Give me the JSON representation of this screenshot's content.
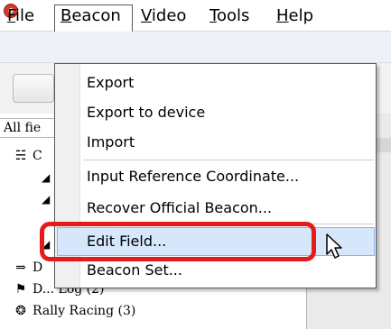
{
  "menubar": {
    "items": [
      {
        "label": "File",
        "underline_index": 0
      },
      {
        "label": "Beacon",
        "underline_index": 0
      },
      {
        "label": "Video",
        "underline_index": 0
      },
      {
        "label": "Tools",
        "underline_index": 0
      },
      {
        "label": "Help",
        "underline_index": 0
      }
    ]
  },
  "filter": {
    "value": "All fie"
  },
  "tree": {
    "rows": [
      {
        "icon": "group-icon",
        "label": "C"
      },
      {
        "icon": "arrow-right-icon",
        "label": "D"
      },
      {
        "icon": "flag-icon",
        "label": "D... Log (2)"
      },
      {
        "icon": "rally-car-icon",
        "label": "Rally Racing (3)"
      }
    ]
  },
  "dropdown": {
    "items": [
      {
        "label": "Export"
      },
      {
        "label": "Export to device"
      },
      {
        "label": "Import"
      },
      {
        "label": "Input Reference Coordinate..."
      },
      {
        "label": "Recover Official Beacon..."
      },
      {
        "label": "Edit Field..."
      },
      {
        "label": "Beacon Set..."
      }
    ],
    "hovered": "Edit Field..."
  },
  "colors": {
    "highlight_ring": "#e51b1b",
    "hover_bg": "#d6e6fb",
    "app_icon": "#d63a26"
  }
}
